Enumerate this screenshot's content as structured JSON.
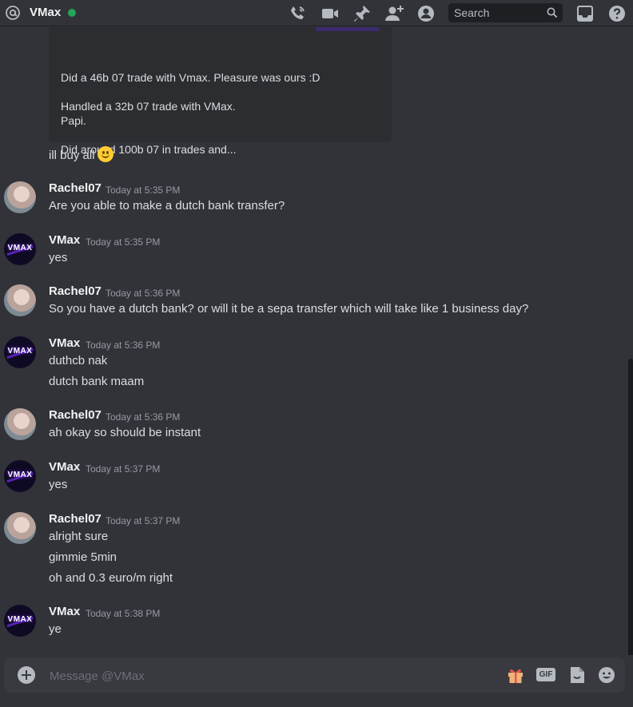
{
  "header": {
    "title": "VMax",
    "search_placeholder": "Search",
    "status_color": "#23a55a",
    "icons": [
      "at-icon",
      "call-icon",
      "video-icon",
      "pin-icon",
      "add-friend-icon",
      "profile-icon",
      "search-icon",
      "inbox-icon",
      "help-icon"
    ]
  },
  "embed": {
    "lines": [
      "Did a 46b 07 trade with Vmax. Pleasure was ours :D",
      "Handled a 32b 07 trade with VMax.",
      "Papi.",
      "Did around 100b 07 in trades and..."
    ]
  },
  "standalone_message": {
    "text": "ill buy all",
    "emoji": "slightly-smiling-face"
  },
  "messages": [
    {
      "author": "Rachel07",
      "timestamp": "Today at 5:35 PM",
      "lines": [
        "Are you able to make a dutch bank transfer?"
      ]
    },
    {
      "author": "VMax",
      "timestamp": "Today at 5:35 PM",
      "lines": [
        "yes"
      ]
    },
    {
      "author": "Rachel07",
      "timestamp": "Today at 5:36 PM",
      "lines": [
        "So you have a dutch bank? or will it be a sepa transfer which will take like 1 business day?"
      ]
    },
    {
      "author": "VMax",
      "timestamp": "Today at 5:36 PM",
      "lines": [
        "duthcb nak",
        "dutch bank maam"
      ]
    },
    {
      "author": "Rachel07",
      "timestamp": "Today at 5:36 PM",
      "lines": [
        "ah okay so should be instant"
      ]
    },
    {
      "author": "VMax",
      "timestamp": "Today at 5:37 PM",
      "lines": [
        "yes"
      ]
    },
    {
      "author": "Rachel07",
      "timestamp": "Today at 5:37 PM",
      "lines": [
        "alright sure",
        "gimmie 5min",
        "oh and 0.3 euro/m right"
      ]
    },
    {
      "author": "VMax",
      "timestamp": "Today at 5:38 PM",
      "lines": [
        "ye"
      ]
    }
  ],
  "avatars": {
    "vmax_text": "VMAX"
  },
  "composer": {
    "placeholder": "Message @VMax",
    "gif_label": "GIF"
  }
}
